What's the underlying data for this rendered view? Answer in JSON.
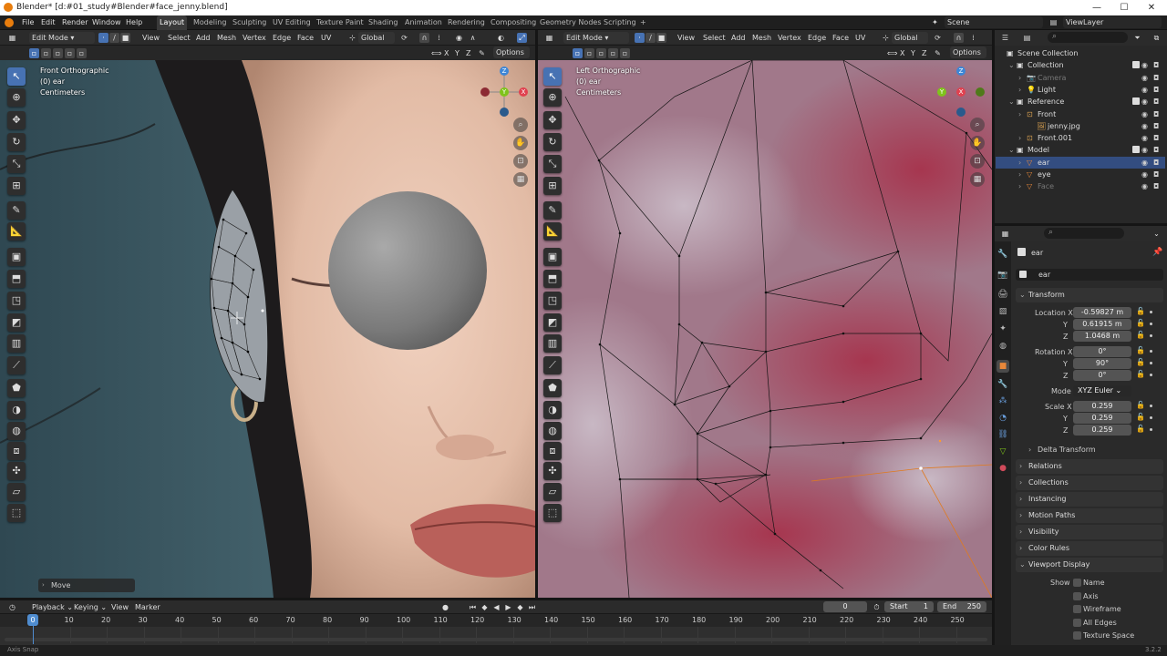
{
  "window": {
    "title": "Blender* [d:#01_study#Blender#face_jenny.blend]",
    "buttons": [
      "—",
      "☐",
      "✕"
    ]
  },
  "menu": [
    "File",
    "Edit",
    "Render",
    "Window",
    "Help"
  ],
  "workspaces": [
    "Layout",
    "Modeling",
    "Sculpting",
    "UV Editing",
    "Texture Paint",
    "Shading",
    "Animation",
    "Rendering",
    "Compositing",
    "Geometry Nodes",
    "Scripting"
  ],
  "add_workspace": "+",
  "scene": {
    "scene_label": "Scene",
    "viewlayer_label": "ViewLayer"
  },
  "left_viewport": {
    "mode": "Edit Mode",
    "menus": [
      "View",
      "Select",
      "Add",
      "Mesh",
      "Vertex",
      "Edge",
      "Face",
      "UV"
    ],
    "transform_orientation": "Global",
    "options": "Options",
    "axes": [
      "X",
      "Y",
      "Z"
    ],
    "overlay": {
      "view": "Front Orthographic",
      "object": "(0) ear",
      "units": "Centimeters"
    },
    "gizmo": {
      "x": "X",
      "y": "Y",
      "z": "Z"
    },
    "last_op": "Move"
  },
  "right_viewport": {
    "mode": "Edit Mode",
    "menus": [
      "View",
      "Select",
      "Add",
      "Mesh",
      "Vertex",
      "Edge",
      "Face",
      "UV"
    ],
    "transform_orientation": "Global",
    "options": "Options",
    "axes": [
      "X",
      "Y",
      "Z"
    ],
    "overlay": {
      "view": "Left Orthographic",
      "object": "(0) ear",
      "units": "Centimeters"
    },
    "gizmo": {
      "x": "X",
      "y": "Y",
      "z": "Z"
    }
  },
  "outliner": {
    "items": [
      {
        "label": "Scene Collection",
        "level": 0,
        "icon": "collection-icon"
      },
      {
        "label": "Collection",
        "level": 1,
        "icon": "collection-icon"
      },
      {
        "label": "Camera",
        "level": 2,
        "icon": "camera-icon",
        "dim": true
      },
      {
        "label": "Light",
        "level": 2,
        "icon": "light-icon"
      },
      {
        "label": "Reference",
        "level": 1,
        "icon": "collection-icon"
      },
      {
        "label": "Front",
        "level": 2,
        "icon": "image-empty-icon"
      },
      {
        "label": "jenny.jpg",
        "level": 3,
        "icon": "image-icon"
      },
      {
        "label": "Front.001",
        "level": 2,
        "icon": "image-empty-icon"
      },
      {
        "label": "Model",
        "level": 1,
        "icon": "collection-icon"
      },
      {
        "label": "ear",
        "level": 2,
        "icon": "mesh-icon",
        "selected": true
      },
      {
        "label": "eye",
        "level": 2,
        "icon": "mesh-icon"
      },
      {
        "label": "Face",
        "level": 2,
        "icon": "mesh-icon",
        "dim": true
      }
    ]
  },
  "properties": {
    "object_name": "ear",
    "mesh_name": "ear",
    "transform_label": "Transform",
    "location": {
      "label": "Location",
      "x_label": "X",
      "y_label": "Y",
      "z_label": "Z",
      "x": "-0.59827 m",
      "y": "0.61915 m",
      "z": "1.0468 m"
    },
    "rotation": {
      "label": "Rotation",
      "x_label": "X",
      "y_label": "Y",
      "z_label": "Z",
      "x": "0°",
      "y": "90°",
      "z": "0°"
    },
    "mode_label": "Mode",
    "mode_value": "XYZ Euler",
    "scale": {
      "label": "Scale",
      "x_label": "X",
      "y_label": "Y",
      "z_label": "Z",
      "x": "0.259",
      "y": "0.259",
      "z": "0.259"
    },
    "delta_transform": "Delta Transform",
    "panels": [
      "Relations",
      "Collections",
      "Instancing",
      "Motion Paths",
      "Visibility",
      "Color Rules",
      "Viewport Display"
    ],
    "show_label": "Show",
    "show_items": [
      "Name",
      "Axis",
      "Wireframe",
      "All Edges",
      "Texture Space"
    ]
  },
  "timeline": {
    "menus": [
      "Playback",
      "Keying",
      "View",
      "Marker"
    ],
    "current_frame": "0",
    "start_label": "Start",
    "start": "1",
    "end_label": "End",
    "end": "250",
    "ticks": [
      "0",
      "10",
      "20",
      "30",
      "40",
      "50",
      "60",
      "70",
      "80",
      "90",
      "100",
      "110",
      "120",
      "130",
      "140",
      "150",
      "160",
      "170",
      "180",
      "190",
      "200",
      "210",
      "220",
      "230",
      "240",
      "250"
    ]
  },
  "status": {
    "left": "Axis Snap",
    "version": "3.2.2"
  },
  "colors": {
    "accent": "#4772b3",
    "selected_row": "#334d80",
    "x_axis": "#e0414f",
    "y_axis": "#7fc31c",
    "z_axis": "#3d86d6",
    "frame_marker": "#4f8ccf"
  }
}
